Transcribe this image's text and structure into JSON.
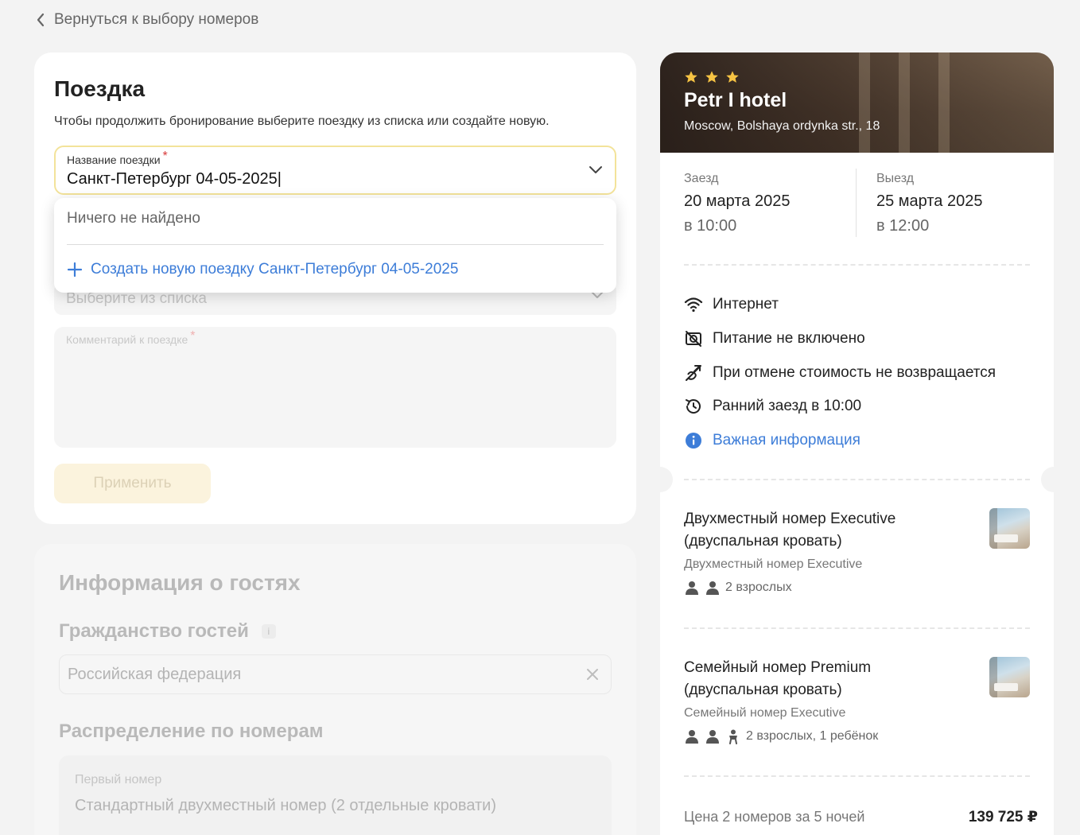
{
  "nav": {
    "back_label": "Вернуться к выбору номеров"
  },
  "trip": {
    "title": "Поездка",
    "description": "Чтобы продолжить бронирование выберите поездку из списка или создайте новую.",
    "name_field": {
      "label": "Название поездки",
      "required_mark": "*",
      "value": "Санкт-Петербург 04-05-2025|"
    },
    "dropdown": {
      "empty_text": "Ничего не найдено",
      "create_label": "Создать новую поездку Санкт-Петербург 04-05-2025"
    },
    "select_placeholder": "Выберите из списка",
    "comment": {
      "label": "Комментарий к поездке",
      "required_mark": "*"
    },
    "apply_label": "Применить"
  },
  "guests": {
    "title": "Информация о гостях",
    "citizenship": {
      "label": "Гражданство гостей",
      "info_glyph": "i",
      "value": "Российская федерация"
    },
    "distribution": {
      "label": "Распределение по номерам",
      "first_room": {
        "label": "Первый номер",
        "value": "Стандартный двухместный номер (2 отдельные кровати)"
      }
    }
  },
  "hotel": {
    "stars": 3,
    "name": "Petr I hotel",
    "address": "Moscow, Bolshaya ordynka str., 18",
    "checkin": {
      "label": "Заезд",
      "date": "20 марта 2025",
      "time": "в 10:00"
    },
    "checkout": {
      "label": "Выезд",
      "date": "25 марта 2025",
      "time": "в 12:00"
    },
    "amenities": [
      {
        "icon": "wifi-icon",
        "text": "Интернет"
      },
      {
        "icon": "no-meal-icon",
        "text": "Питание не включено"
      },
      {
        "icon": "non-refundable-icon",
        "text": "При отмене стоимость не возвращается"
      },
      {
        "icon": "early-checkin-icon",
        "text": "Ранний заезд в 10:00"
      }
    ],
    "important_info": "Важная информация",
    "rooms": [
      {
        "title": "Двухместный номер Executive (двуспальная кровать)",
        "subtitle": "Двухместный номер Executive",
        "occupancy": "2 взрослых"
      },
      {
        "title": "Семейный номер Premium (двуспальная кровать)",
        "subtitle": "Семейный номер Executive",
        "occupancy": "2 взрослых, 1 ребёнок"
      }
    ],
    "price": {
      "label": "Цена 2 номеров за 5 ночей",
      "value": "139 725 ₽"
    }
  },
  "colors": {
    "accent_blue": "#3d7dd8",
    "star": "#f6c343",
    "required": "#d83a3a",
    "focus_border": "#f3e39a"
  }
}
